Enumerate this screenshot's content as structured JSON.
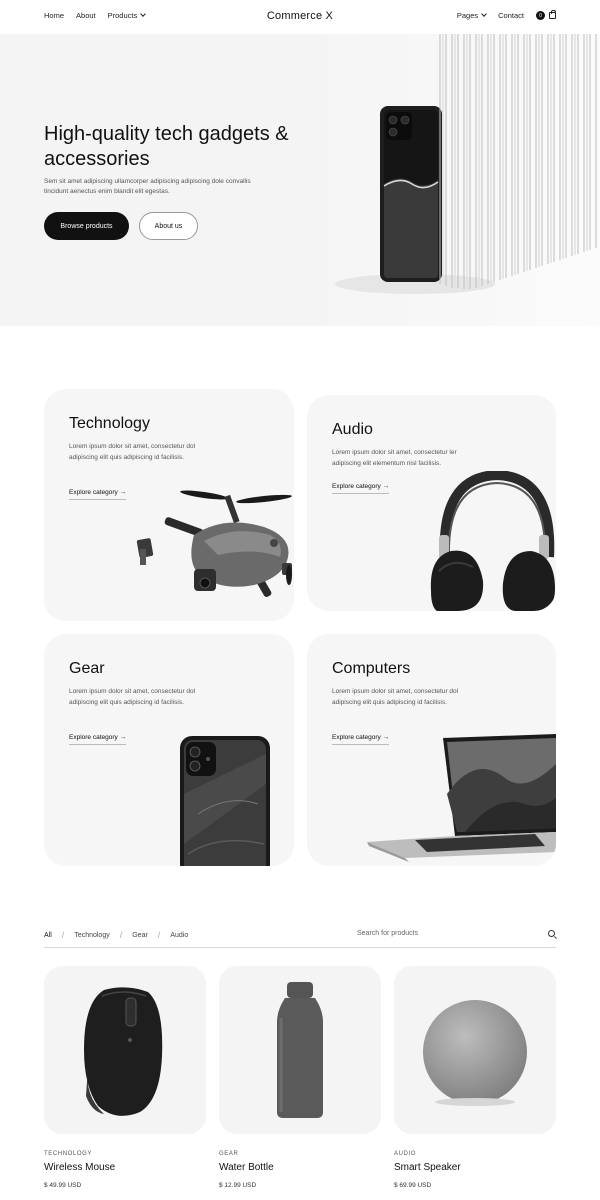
{
  "nav": {
    "home": "Home",
    "about": "About",
    "products": "Products",
    "brand": "Commerce X",
    "pages": "Pages",
    "contact": "Contact",
    "cart_count": "0"
  },
  "hero": {
    "title": "High-quality tech gadgets & accessories",
    "subtitle": "Sem sit amet adipiscing ullamcorper adipiscing adipiscing dole convallis tincidunt aenectus enim blandit elit egestas.",
    "primary_button": "Browse products",
    "secondary_button": "About us"
  },
  "categories": [
    {
      "title": "Technology",
      "desc": "Lorem ipsum dolor sit amet, consectetur dol adipiscing elit quis adipiscing id facilisis.",
      "link": "Explore category →"
    },
    {
      "title": "Audio",
      "desc": "Lorem ipsum dolor sit amet, consectetur ler adipiscing elit elementum nisl facilisis.",
      "link": "Explore category →"
    },
    {
      "title": "Gear",
      "desc": "Lorem ipsum dolor sit amet, consectetur dol adipiscing elit quis adipiscing id facilisis.",
      "link": "Explore category →"
    },
    {
      "title": "Computers",
      "desc": "Lorem ipsum dolor sit amet, consectetur dol adipiscing elit quis adipiscing id facilisis.",
      "link": "Explore category →"
    }
  ],
  "filters": {
    "all": "All",
    "technology": "Technology",
    "gear": "Gear",
    "audio": "Audio",
    "separator": "/",
    "search_placeholder": "Search for products"
  },
  "products": [
    {
      "category": "TECHNOLOGY",
      "name": "Wireless Mouse",
      "price": "$ 49.99 USD"
    },
    {
      "category": "GEAR",
      "name": "Water Bottle",
      "price": "$ 12.99 USD"
    },
    {
      "category": "AUDIO",
      "name": "Smart Speaker",
      "price": "$ 69.99 USD"
    }
  ],
  "icons": {
    "products_menu": "chevron-down-icon",
    "pages_menu": "chevron-down-icon",
    "cart": "bag-icon",
    "search": "search-icon"
  }
}
